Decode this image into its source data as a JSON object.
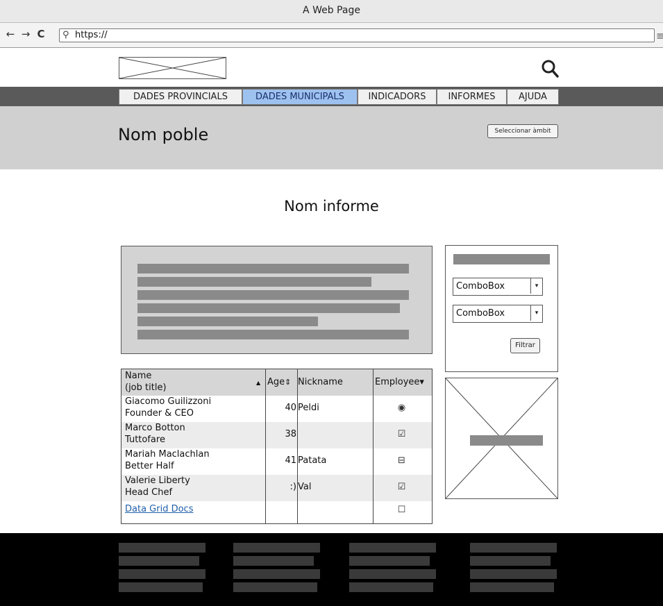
{
  "window": {
    "title": "A Web Page"
  },
  "browser": {
    "back_icon": "←",
    "forward_icon": "→",
    "reload_icon": "C",
    "search_icon": "⚲",
    "url": "https://",
    "menu_icon": "≡"
  },
  "nav": {
    "tabs": [
      {
        "label": "DADES PROVINCIALS"
      },
      {
        "label": "DADES MUNICIPALS",
        "active": true
      },
      {
        "label": "INDICADORS"
      },
      {
        "label": "INFORMES"
      },
      {
        "label": "AJUDA"
      }
    ]
  },
  "banner": {
    "town_name": "Nom poble",
    "scope_button": "Seleccionar àmbit"
  },
  "report": {
    "title": "Nom informe"
  },
  "filters": {
    "combo1": {
      "value": "ComboBox",
      "arrow": "▾"
    },
    "combo2": {
      "value": "ComboBox",
      "arrow": "▾"
    },
    "button": "Filtrar"
  },
  "grid": {
    "headers": {
      "name_line1": "Name",
      "name_line2": "(job title)",
      "name_sort": "▲",
      "age": "Age",
      "age_sort": "⇕",
      "nickname": "Nickname",
      "employee": "Employee",
      "employee_sort": "▾"
    },
    "rows": [
      {
        "name": "Giacomo Guilizzoni",
        "title": "Founder & CEO",
        "age": "40",
        "nickname": "Peldi",
        "employee": "◉"
      },
      {
        "name": "Marco Botton",
        "title": "Tuttofare",
        "age": "38",
        "nickname": "",
        "employee": "☑"
      },
      {
        "name": "Mariah Maclachlan",
        "title": "Better Half",
        "age": "41",
        "nickname": "Patata",
        "employee": "⊟"
      },
      {
        "name": "Valerie Liberty",
        "title": "Head Chef",
        "age": ":)",
        "nickname": "Val",
        "employee": "☑"
      }
    ],
    "link_row": {
      "label": "Data Grid Docs",
      "employee": "☐"
    }
  },
  "colors": {
    "nav_bar": "#5a5a5a",
    "active_tab": "#9ec2f0",
    "banner": "#d0d0d0",
    "placeholder_bar": "#8a8a8a",
    "footer": "#000000",
    "link": "#1f5fa8"
  }
}
